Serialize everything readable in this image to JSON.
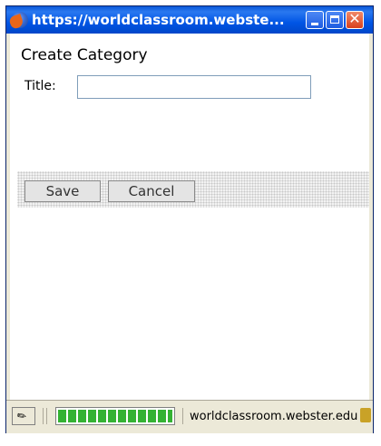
{
  "window": {
    "title": "https://worldclassroom.webste...",
    "icons": {
      "browser": "firefox-icon",
      "minimize": "minimize-icon",
      "maximize": "maximize-icon",
      "close": "close-icon"
    }
  },
  "form": {
    "heading": "Create Category",
    "title_label": "Title:",
    "title_value": "",
    "title_placeholder": "",
    "save_label": "Save",
    "cancel_label": "Cancel"
  },
  "statusbar": {
    "icon": "pen-icon",
    "progress": 1.0,
    "url": "worldclassroom.webster.edu",
    "lock_icon": "lock-icon"
  },
  "colors": {
    "titlebar": "#0055e5",
    "progress": "#34b233",
    "close_button": "#d9411d"
  }
}
